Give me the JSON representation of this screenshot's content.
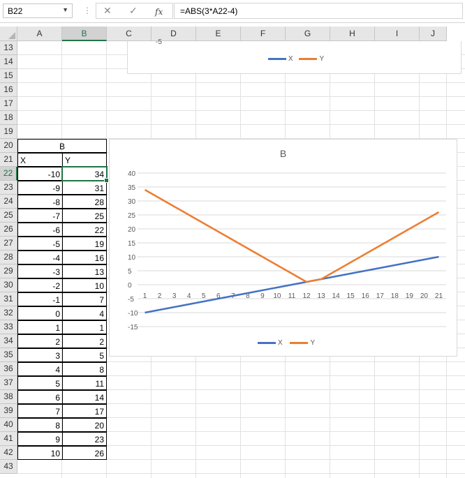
{
  "name_box": {
    "value": "B22"
  },
  "formula_bar": {
    "formula": "=ABS(3*A22-4)",
    "fx_label": "fx",
    "cancel_icon": "close-icon",
    "enter_icon": "check-icon"
  },
  "columns": [
    "A",
    "B",
    "C",
    "D",
    "E",
    "F",
    "G",
    "H",
    "I",
    "J"
  ],
  "selected_column": "B",
  "rows": [
    13,
    14,
    15,
    16,
    17,
    18,
    19,
    20,
    21,
    22,
    23,
    24,
    25,
    26,
    27,
    28,
    29,
    30,
    31,
    32,
    33,
    34,
    35,
    36,
    37,
    38,
    39,
    40,
    41,
    42,
    43
  ],
  "selected_row": 22,
  "table": {
    "header": "B",
    "col_labels": [
      "X",
      "Y"
    ],
    "x": [
      -10,
      -9,
      -8,
      -7,
      -6,
      -5,
      -4,
      -3,
      -2,
      -1,
      0,
      1,
      2,
      3,
      4,
      5,
      6,
      7,
      8,
      9,
      10
    ],
    "y": [
      34,
      31,
      28,
      25,
      22,
      19,
      16,
      13,
      10,
      7,
      4,
      1,
      2,
      5,
      8,
      11,
      14,
      17,
      20,
      23,
      26
    ]
  },
  "top_chart": {
    "partial_label": "-5",
    "legend": [
      "X",
      "Y"
    ]
  },
  "chart_data": {
    "type": "line",
    "title": "B",
    "categories": [
      "1",
      "2",
      "3",
      "4",
      "5",
      "6",
      "7",
      "8",
      "9",
      "10",
      "11",
      "12",
      "13",
      "14",
      "15",
      "16",
      "17",
      "18",
      "19",
      "20",
      "21"
    ],
    "series": [
      {
        "name": "X",
        "color": "#4472c4",
        "values": [
          -10,
          -9,
          -8,
          -7,
          -6,
          -5,
          -4,
          -3,
          -2,
          -1,
          0,
          1,
          2,
          3,
          4,
          5,
          6,
          7,
          8,
          9,
          10
        ]
      },
      {
        "name": "Y",
        "color": "#ed7d31",
        "values": [
          34,
          31,
          28,
          25,
          22,
          19,
          16,
          13,
          10,
          7,
          4,
          1,
          2,
          5,
          8,
          11,
          14,
          17,
          20,
          23,
          26
        ]
      }
    ],
    "ylim": [
      -15,
      40
    ],
    "yticks": [
      "40",
      "35",
      "30",
      "25",
      "20",
      "15",
      "10",
      "5",
      "0",
      "-5",
      "-10",
      "-15"
    ],
    "grid": true,
    "legend_position": "bottom"
  }
}
